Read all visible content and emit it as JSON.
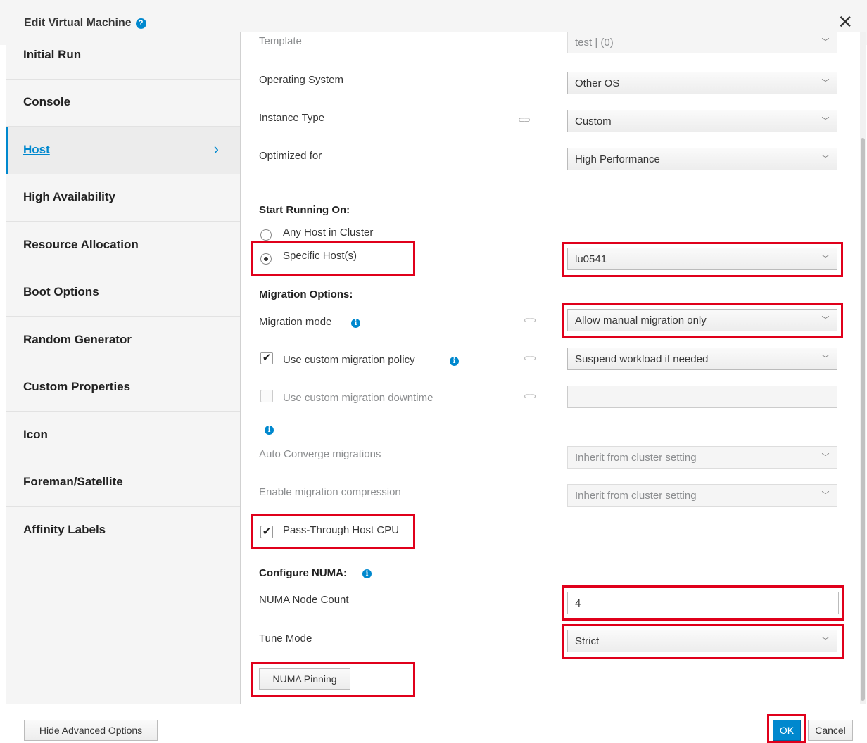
{
  "dialog": {
    "title": "Edit Virtual Machine",
    "close_label": "✕"
  },
  "sidebar": {
    "items": [
      {
        "label": "Initial Run"
      },
      {
        "label": "Console"
      },
      {
        "label": "Host"
      },
      {
        "label": "High Availability"
      },
      {
        "label": "Resource Allocation"
      },
      {
        "label": "Boot Options"
      },
      {
        "label": "Random Generator"
      },
      {
        "label": "Custom Properties"
      },
      {
        "label": "Icon"
      },
      {
        "label": "Foreman/Satellite"
      },
      {
        "label": "Affinity Labels"
      }
    ],
    "active": "Host"
  },
  "form": {
    "template": {
      "label": "Template",
      "value": "test | (0)"
    },
    "os": {
      "label": "Operating System",
      "value": "Other OS"
    },
    "instance_type": {
      "label": "Instance Type",
      "value": "Custom"
    },
    "optimized_for": {
      "label": "Optimized for",
      "value": "High Performance"
    },
    "start_running_on": {
      "title": "Start Running On:",
      "any_host": "Any Host in Cluster",
      "specific_host": "Specific Host(s)",
      "host_value": "lu0541"
    },
    "migration": {
      "title": "Migration Options:",
      "mode_label": "Migration mode",
      "mode_value": "Allow manual migration only",
      "custom_policy_label": "Use custom migration policy",
      "custom_policy_value": "Suspend workload if needed",
      "custom_downtime_label": "Use custom migration downtime",
      "auto_converge_label": "Auto Converge migrations",
      "auto_converge_value": "Inherit from cluster setting",
      "compression_label": "Enable migration compression",
      "compression_value": "Inherit from cluster setting"
    },
    "passthrough_cpu": "Pass-Through Host CPU",
    "numa": {
      "title": "Configure NUMA:",
      "node_count_label": "NUMA Node Count",
      "node_count_value": "4",
      "tune_mode_label": "Tune Mode",
      "tune_mode_value": "Strict",
      "pinning_button": "NUMA Pinning"
    }
  },
  "footer": {
    "hide_advanced": "Hide Advanced Options",
    "ok": "OK",
    "cancel": "Cancel"
  },
  "colors": {
    "accent": "#0088ce",
    "highlight": "#e0001b"
  }
}
